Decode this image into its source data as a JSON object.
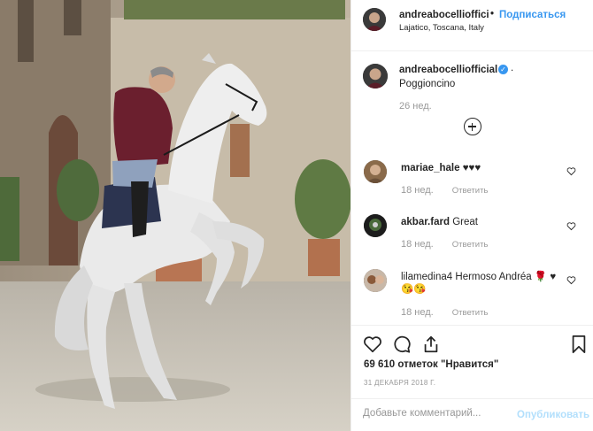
{
  "post": {
    "photo_alt": "rider on rearing white horse in courtyard",
    "header": {
      "username": "andreabocelliofficial",
      "separator": "•",
      "follow_label": "Подписаться",
      "location": "Lajatico, Toscana, Italy"
    },
    "caption": {
      "username": "andreabocelliofficial",
      "verified_mark": "✓",
      "trailing": ".",
      "text": "Poggioncino",
      "time": "26 нед."
    },
    "comments": [
      {
        "username": "mariae_hale",
        "text": "♥♥♥",
        "time": "18 нед.",
        "reply_label": "Ответить"
      },
      {
        "username": "akbar.fard",
        "text": "Great",
        "time": "18 нед.",
        "reply_label": "Ответить"
      },
      {
        "username": "lilamedina4",
        "text": "Hermoso Andréa 🌹 ♥😘😘",
        "time": "18 нед.",
        "reply_label": "Ответить"
      }
    ],
    "likes_text": "69 610 отметок \"Нравится\"",
    "date": "31 ДЕКАБРЯ 2018 Г.",
    "add_comment_placeholder": "Добавьте комментарий...",
    "publish_label": "Опубликовать",
    "colors": {
      "link_blue": "#3897f0",
      "muted": "#999999",
      "publish_disabled": "#b2dffc"
    },
    "icons": [
      "heart-icon",
      "comment-icon",
      "share-icon",
      "bookmark-icon",
      "plus-circle-icon",
      "verified-badge-icon"
    ]
  }
}
